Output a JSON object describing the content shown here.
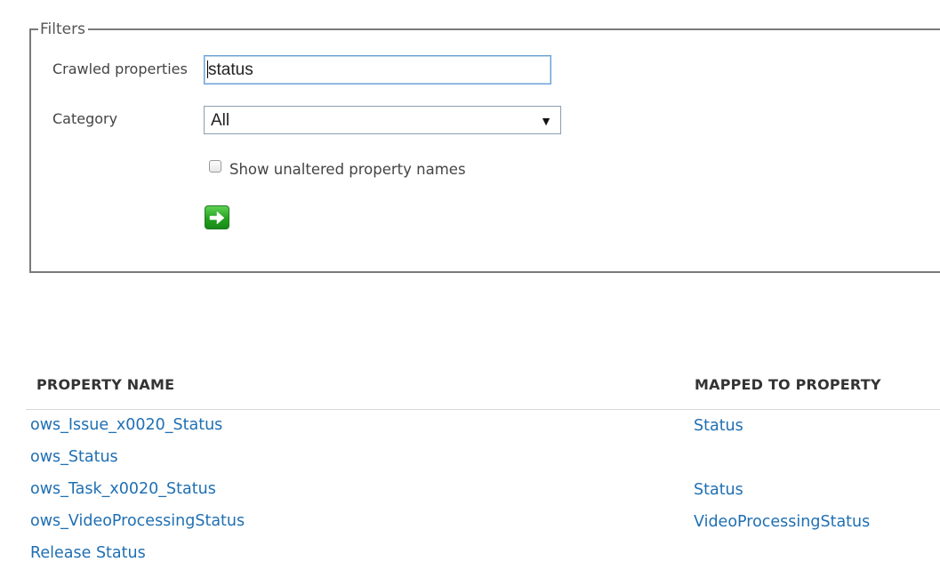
{
  "filters": {
    "legend": "Filters",
    "crawled_label": "Crawled properties",
    "crawled_value": "status",
    "category_label": "Category",
    "category_value": "All",
    "show_unaltered_label": "Show unaltered property names",
    "show_unaltered_checked": false,
    "go_icon": "green-arrow-right-icon"
  },
  "table": {
    "headers": {
      "property_name": "PROPERTY NAME",
      "mapped_to": "MAPPED TO PROPERTY"
    },
    "rows": [
      {
        "name": "ows_Issue_x0020_Status",
        "mapped": "Status"
      },
      {
        "name": "ows_Status",
        "mapped": ""
      },
      {
        "name": "ows_Task_x0020_Status",
        "mapped": "Status"
      },
      {
        "name": "ows_VideoProcessingStatus",
        "mapped": "VideoProcessingStatus"
      },
      {
        "name": "Release Status",
        "mapped": ""
      }
    ]
  },
  "colors": {
    "link": "#1f6fb2",
    "border": "#7a7a7a",
    "input_focus": "#6a9fd6"
  }
}
